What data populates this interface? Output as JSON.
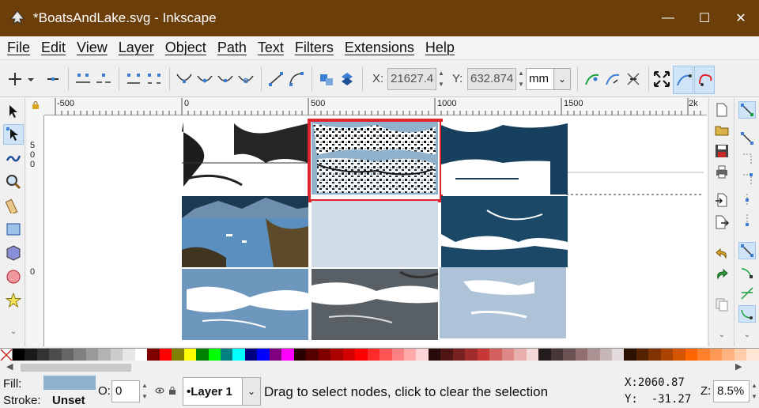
{
  "window": {
    "title": "*BoatsAndLake.svg - Inkscape",
    "minimize_glyph": "—",
    "maximize_glyph": "☐",
    "close_glyph": "✕"
  },
  "menu": [
    "File",
    "Edit",
    "View",
    "Layer",
    "Object",
    "Path",
    "Text",
    "Filters",
    "Extensions",
    "Help"
  ],
  "tool_controls": {
    "x_label": "X:",
    "x_value": "21627.4",
    "y_label": "Y:",
    "y_value": "632.874",
    "unit": "mm"
  },
  "ruler": {
    "h_labels": [
      "-500",
      "0",
      "500",
      "1000",
      "1500",
      "2k"
    ],
    "v_labels": [
      "5",
      "0",
      "0",
      "0"
    ]
  },
  "status": {
    "fill_label": "Fill:",
    "stroke_label": "Stroke:",
    "stroke_value": "Unset",
    "opacity_label": "O:",
    "opacity_value": "0",
    "layer_name": "•Layer 1",
    "message": "Drag to select nodes, click to clear the selection",
    "x_readout": "X:2060.87",
    "y_readout": "Y:  -31.27",
    "zoom_label": "Z:",
    "zoom_value": "8.5%"
  },
  "colors": {
    "titlebar": "#6b3e0a",
    "fill_swatch": "#8fb1cc",
    "selection": "#e0242c",
    "accent_active": "#cfe4f7"
  },
  "tools": [
    "selector-tool",
    "node-tool",
    "tweak-tool",
    "zoom-tool",
    "measure-tool",
    "rect-tool",
    "3dbox-tool",
    "ellipse-tool",
    "star-tool"
  ],
  "palette": [
    "#000000",
    "#1a1a1a",
    "#333333",
    "#4d4d4d",
    "#666666",
    "#808080",
    "#999999",
    "#b3b3b3",
    "#cccccc",
    "#e6e6e6",
    "#ffffff",
    "#800000",
    "#ff0000",
    "#808000",
    "#ffff00",
    "#008000",
    "#00ff00",
    "#008080",
    "#00ffff",
    "#000080",
    "#0000ff",
    "#800080",
    "#ff00ff",
    "#2b0000",
    "#550000",
    "#800000",
    "#aa0000",
    "#d40000",
    "#ff0000",
    "#ff2a2a",
    "#ff5555",
    "#ff8080",
    "#ffaaaa",
    "#ffd5d5",
    "#280b0b",
    "#501616",
    "#782121",
    "#a02c2c",
    "#c83737",
    "#d35f5f",
    "#de8787",
    "#e9afaf",
    "#f4d7d7",
    "#241c1c",
    "#483737",
    "#6c5353",
    "#916f6f",
    "#ac9393",
    "#c8b7b7",
    "#e3dbdb",
    "#2b1100",
    "#552200",
    "#803300",
    "#aa4400",
    "#d45500",
    "#ff6600",
    "#ff7f2a",
    "#ff9955",
    "#ffb380",
    "#ffccaa",
    "#ffe6d5"
  ]
}
